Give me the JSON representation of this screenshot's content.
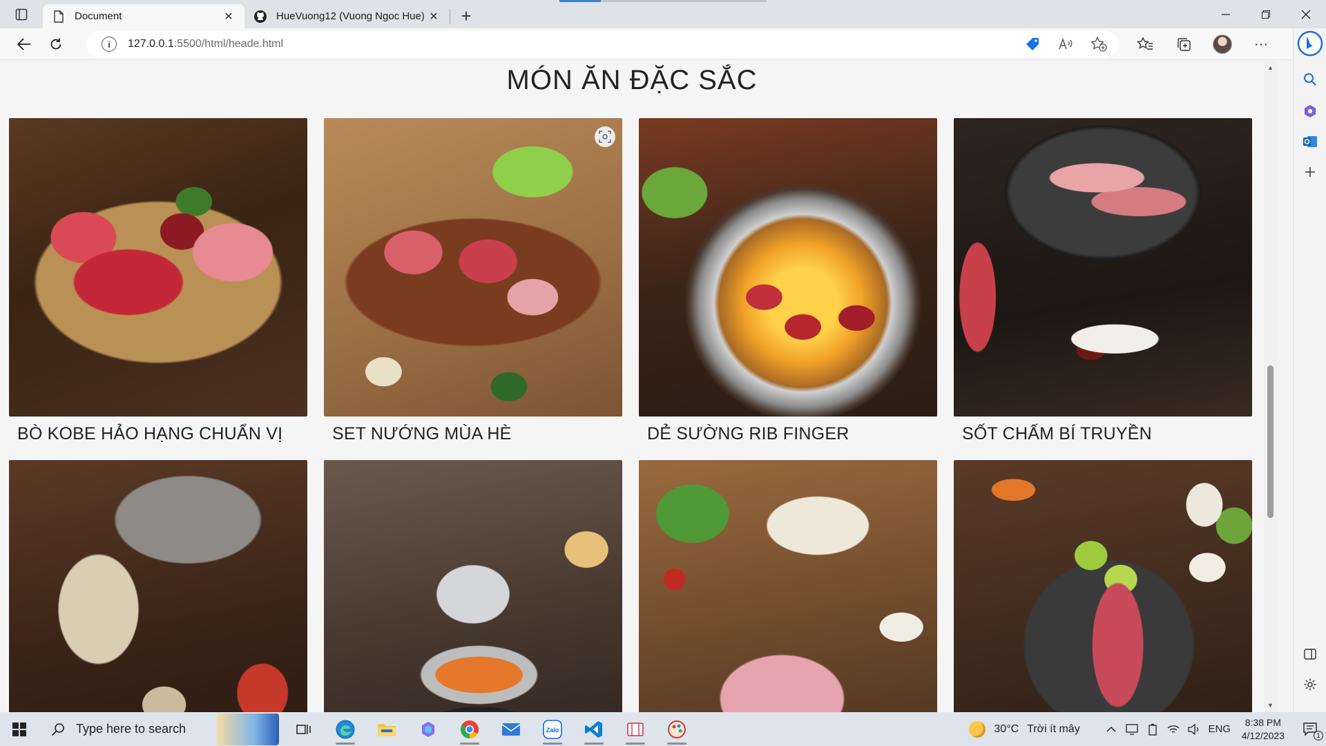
{
  "browser": {
    "tabs": [
      {
        "title": "Document",
        "active": true,
        "icon": "document-icon"
      },
      {
        "title": "HueVuong12 (Vuong Ngoc Hue)",
        "active": false,
        "icon": "github-icon"
      }
    ],
    "new_tab_label": "+",
    "url_host": "127.0.0.1",
    "url_path": ":5500/html/heade.html"
  },
  "page": {
    "title": "MÓN ĂN ĐẶC SẮC",
    "dishes": [
      {
        "name": "BÒ KOBE HẢO HẠNG CHUẨN VỊ"
      },
      {
        "name": "SET NƯỚNG MÙA HÈ"
      },
      {
        "name": "DẺ SƯỜNG RIB FINGER"
      },
      {
        "name": "SỐT CHẤM BÍ TRUYỀN"
      },
      {
        "name": ""
      },
      {
        "name": ""
      },
      {
        "name": ""
      },
      {
        "name": ""
      }
    ]
  },
  "taskbar": {
    "search_placeholder": "Type here to search",
    "weather_temp": "30°C",
    "weather_text": "Trời ít mây",
    "language": "ENG",
    "time": "8:38 PM",
    "date": "4/12/2023",
    "notification_count": "1"
  },
  "colors": {
    "accent": "#3b82c4",
    "page_bg": "#f5f5f5",
    "taskbar_bg": "#dee4ec"
  }
}
